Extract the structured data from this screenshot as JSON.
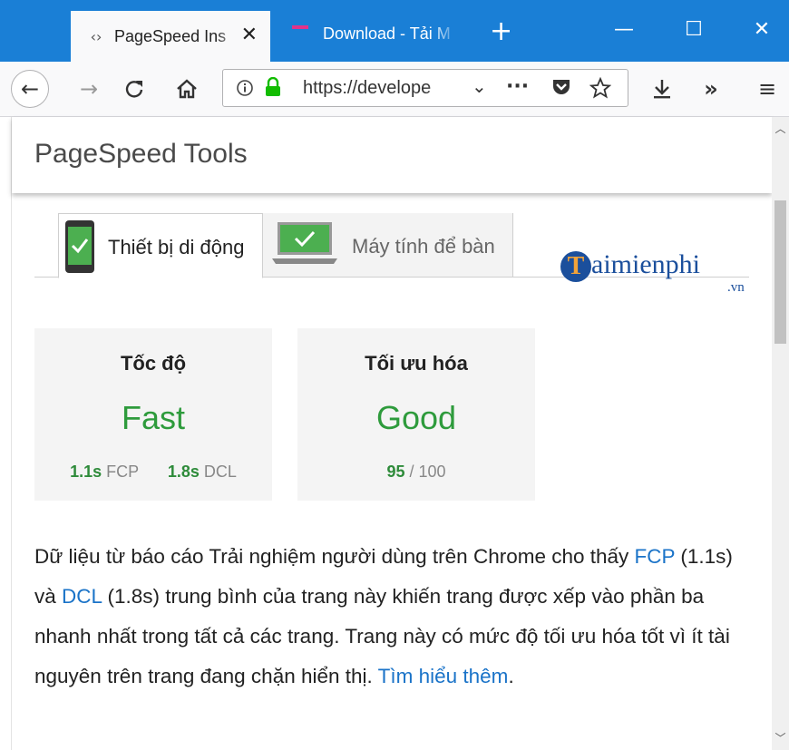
{
  "browser": {
    "tabs": [
      {
        "title": "PageSpeed Ins",
        "active": true
      },
      {
        "title": "Download - Tải M",
        "active": false
      }
    ],
    "new_tab_glyph": "+",
    "window_controls": {
      "minimize": "—",
      "maximize": "☐",
      "close": "✕"
    },
    "url": "https://develope",
    "icons": [
      "back-arrow-icon",
      "forward-arrow-icon",
      "reload-icon",
      "home-icon",
      "info-icon",
      "lock-icon",
      "chevron-down-icon",
      "more-icon",
      "pocket-icon",
      "star-icon",
      "download-icon",
      "overflow-icon",
      "menu-icon"
    ]
  },
  "page": {
    "header_title": "PageSpeed Tools",
    "tabs": [
      {
        "label": "Thiết bị di động",
        "selected": true
      },
      {
        "label": "Máy tính để bàn",
        "selected": false
      }
    ],
    "watermark": {
      "letter": "T",
      "text": "aimienphi",
      "suffix": ".vn"
    },
    "cards": {
      "speed": {
        "title": "Tốc độ",
        "value": "Fast",
        "fcp_value": "1.1s",
        "fcp_label": "FCP",
        "dcl_value": "1.8s",
        "dcl_label": "DCL"
      },
      "optimization": {
        "title": "Tối ưu hóa",
        "value": "Good",
        "score": "95",
        "score_max": "/ 100"
      }
    },
    "description": {
      "p1": "Dữ liệu từ báo cáo Trải nghiệm người dùng trên Chrome cho thấy ",
      "link_fcp": "FCP",
      "p2": " (1.1s) và ",
      "link_dcl": "DCL",
      "p3": " (1.8s) trung bình của trang này khiến trang được xếp vào phần ba nhanh nhất trong tất cả các trang. Trang này có mức độ tối ưu hóa tốt vì ít tài nguyên trên trang đang chặn hiển thị. ",
      "link_learn": "Tìm hiểu thêm",
      "end": "."
    }
  },
  "colors": {
    "titlebar": "#1a7fd6",
    "good_green": "#2e9b3c",
    "link_blue": "#1a73c8"
  }
}
